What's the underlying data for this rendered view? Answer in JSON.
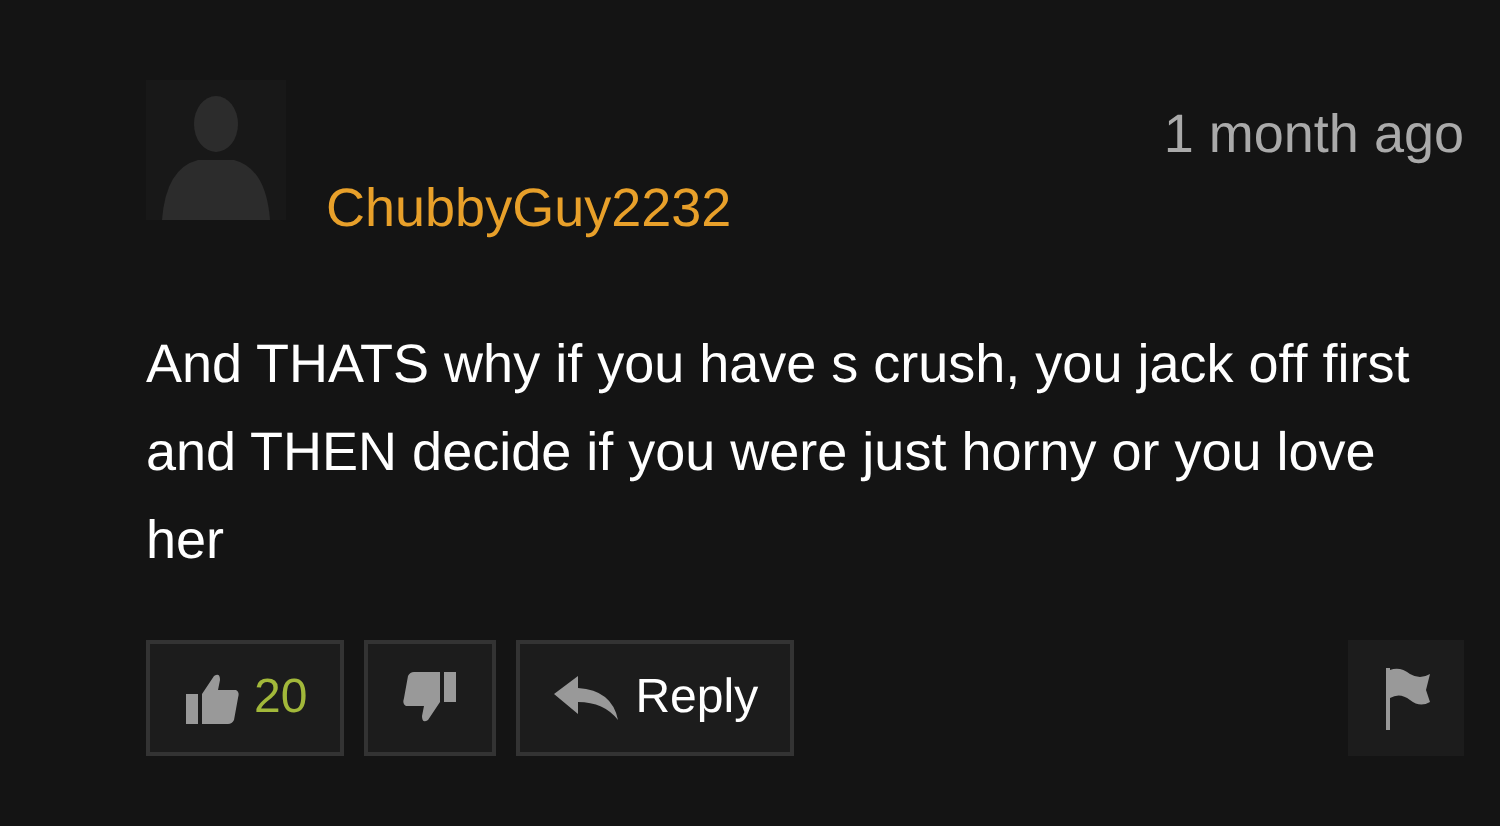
{
  "comment": {
    "timestamp": "1 month ago",
    "username": "ChubbyGuy2232",
    "body": "And THATS why if you have s crush, you jack off first and THEN decide if you were just horny or you love her",
    "upvotes": "20",
    "reply_label": "Reply"
  }
}
